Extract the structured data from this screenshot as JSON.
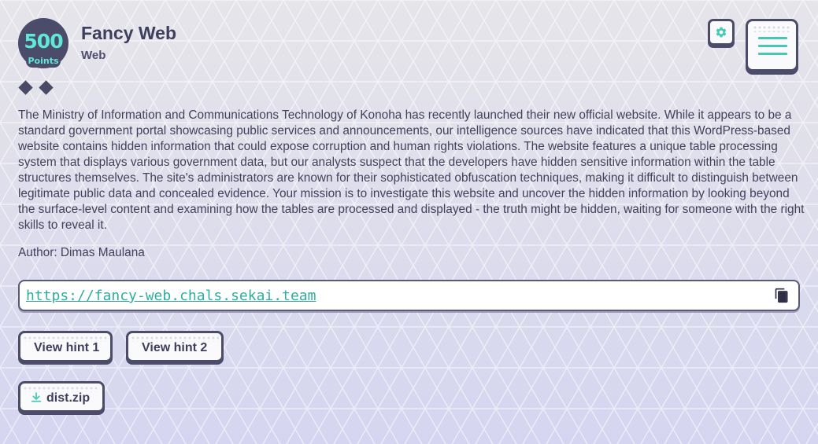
{
  "challenge": {
    "points": "500",
    "points_label": "Points",
    "title": "Fancy Web",
    "category": "Web",
    "difficulty_markers": 2,
    "description": "The Ministry of Information and Communications Technology of Konoha has recently launched their new official website. While it appears to be a standard government portal showcasing public services and announcements, our intelligence sources have indicated that this WordPress-based website contains hidden information that could expose corruption and human rights violations. The website features a unique table processing system that displays various government data, but our analysts suspect that the developers have hidden sensitive information within the table structures themselves. The site's administrators are known for their sophisticated obfuscation techniques, making it difficult to distinguish between legitimate public data and concealed evidence. Your mission is to investigate this website and uncover the hidden information by looking beyond the surface-level content and examining how the tables are processed and displayed - the truth might be hidden, waiting for someone with the right skills to reveal it.",
    "author": "Author: Dimas Maulana",
    "url": "https://fancy-web.chals.sekai.team"
  },
  "hints": [
    {
      "label": "View hint 1"
    },
    {
      "label": "View hint 2"
    }
  ],
  "files": [
    {
      "name": "dist.zip",
      "icon": "download-icon"
    }
  ],
  "toolbar": {
    "settings_icon": "gear-icon",
    "menu_icon": "hamburger-menu-icon"
  },
  "colors": {
    "accent": "#43c9b5",
    "link": "#2fae9d",
    "dark": "#4b4b6a",
    "badge_text": "#5fe8d6"
  }
}
